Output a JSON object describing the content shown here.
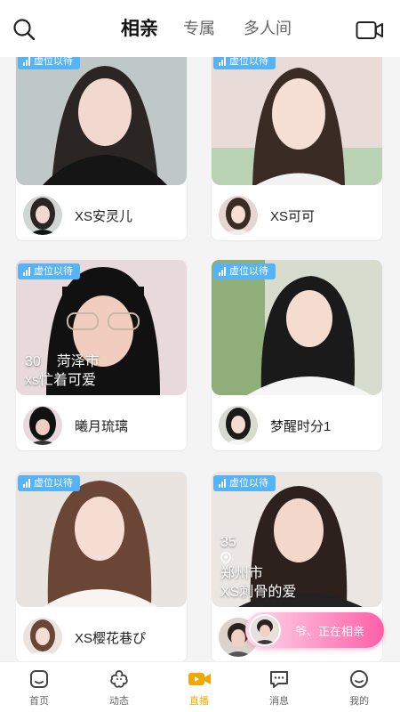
{
  "header": {
    "tabs": [
      {
        "label": "相亲",
        "active": true
      },
      {
        "label": "专属",
        "active": false
      },
      {
        "label": "多人间",
        "active": false
      }
    ],
    "icons": {
      "left": "search-icon",
      "right": "video-camera-icon"
    }
  },
  "cards": [
    {
      "badge": "虚位以待",
      "name": "XS安灵儿",
      "age": "",
      "city": "",
      "subtitle": ""
    },
    {
      "badge": "虚位以待",
      "name": "XS可可",
      "age": "",
      "city": "",
      "subtitle": ""
    },
    {
      "badge": "虚位以待",
      "name": "曦月琉璃",
      "age": "30",
      "city": "菏泽市",
      "subtitle": "xs忙着可爱"
    },
    {
      "badge": "虚位以待",
      "name": "梦醒时分1",
      "age": "",
      "city": "",
      "subtitle": ""
    },
    {
      "badge": "虚位以待",
      "name": "XS樱花巷ぴ",
      "age": "",
      "city": "",
      "subtitle": ""
    },
    {
      "badge": "虚位以待",
      "name": "",
      "age": "35",
      "city": "郑州市",
      "subtitle": "XS刺骨的爱"
    }
  ],
  "floating": {
    "text": "爷、正在相亲"
  },
  "nav": [
    {
      "label": "首页",
      "icon": "home-icon",
      "active": false
    },
    {
      "label": "动态",
      "icon": "flower-icon",
      "active": false
    },
    {
      "label": "直播",
      "icon": "live-video-icon",
      "active": true
    },
    {
      "label": "消息",
      "icon": "message-icon",
      "active": false
    },
    {
      "label": "我的",
      "icon": "profile-icon",
      "active": false
    }
  ],
  "colors": {
    "accent": "#f0a800",
    "badge": "#56b3f5",
    "pill": "#ff5fa8"
  }
}
